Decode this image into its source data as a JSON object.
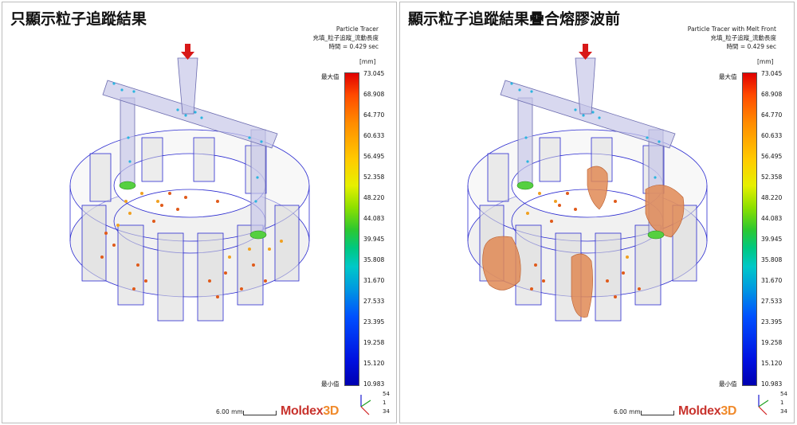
{
  "panels": [
    {
      "title": "只顯示粒子追蹤結果",
      "header": [
        "Particle Tracer",
        "充填_粒子追蹤_流動長度",
        "時間 = 0.429 sec"
      ],
      "show_melt_front": false
    },
    {
      "title": "顯示粒子追蹤結果疊合熔膠波前",
      "header": [
        "Particle Tracer with Melt Front",
        "充填_粒子追蹤_流動長度",
        "時間 = 0.429 sec"
      ],
      "show_melt_front": true
    }
  ],
  "legend": {
    "unit": "[mm]",
    "max_label": "最大值",
    "min_label": "最小值",
    "ticks": [
      "73.045",
      "68.908",
      "64.770",
      "60.633",
      "56.495",
      "52.358",
      "48.220",
      "44.083",
      "39.945",
      "35.808",
      "31.670",
      "27.533",
      "23.395",
      "19.258",
      "15.120",
      "10.983"
    ]
  },
  "scale_label": "6.00 mm",
  "logo": {
    "part1": "Moldex",
    "part2": "3D"
  },
  "axis_values": [
    "54",
    "1",
    "34"
  ],
  "colors": {
    "melt_front": "#e08a55",
    "particle_hot": "#e05a1a",
    "particle_warm": "#f0a020",
    "runner_particle": "#2bb5e0",
    "gate": "#55d040",
    "mesh": "#2a2ad0",
    "inlet_arrow": "#d81818"
  }
}
